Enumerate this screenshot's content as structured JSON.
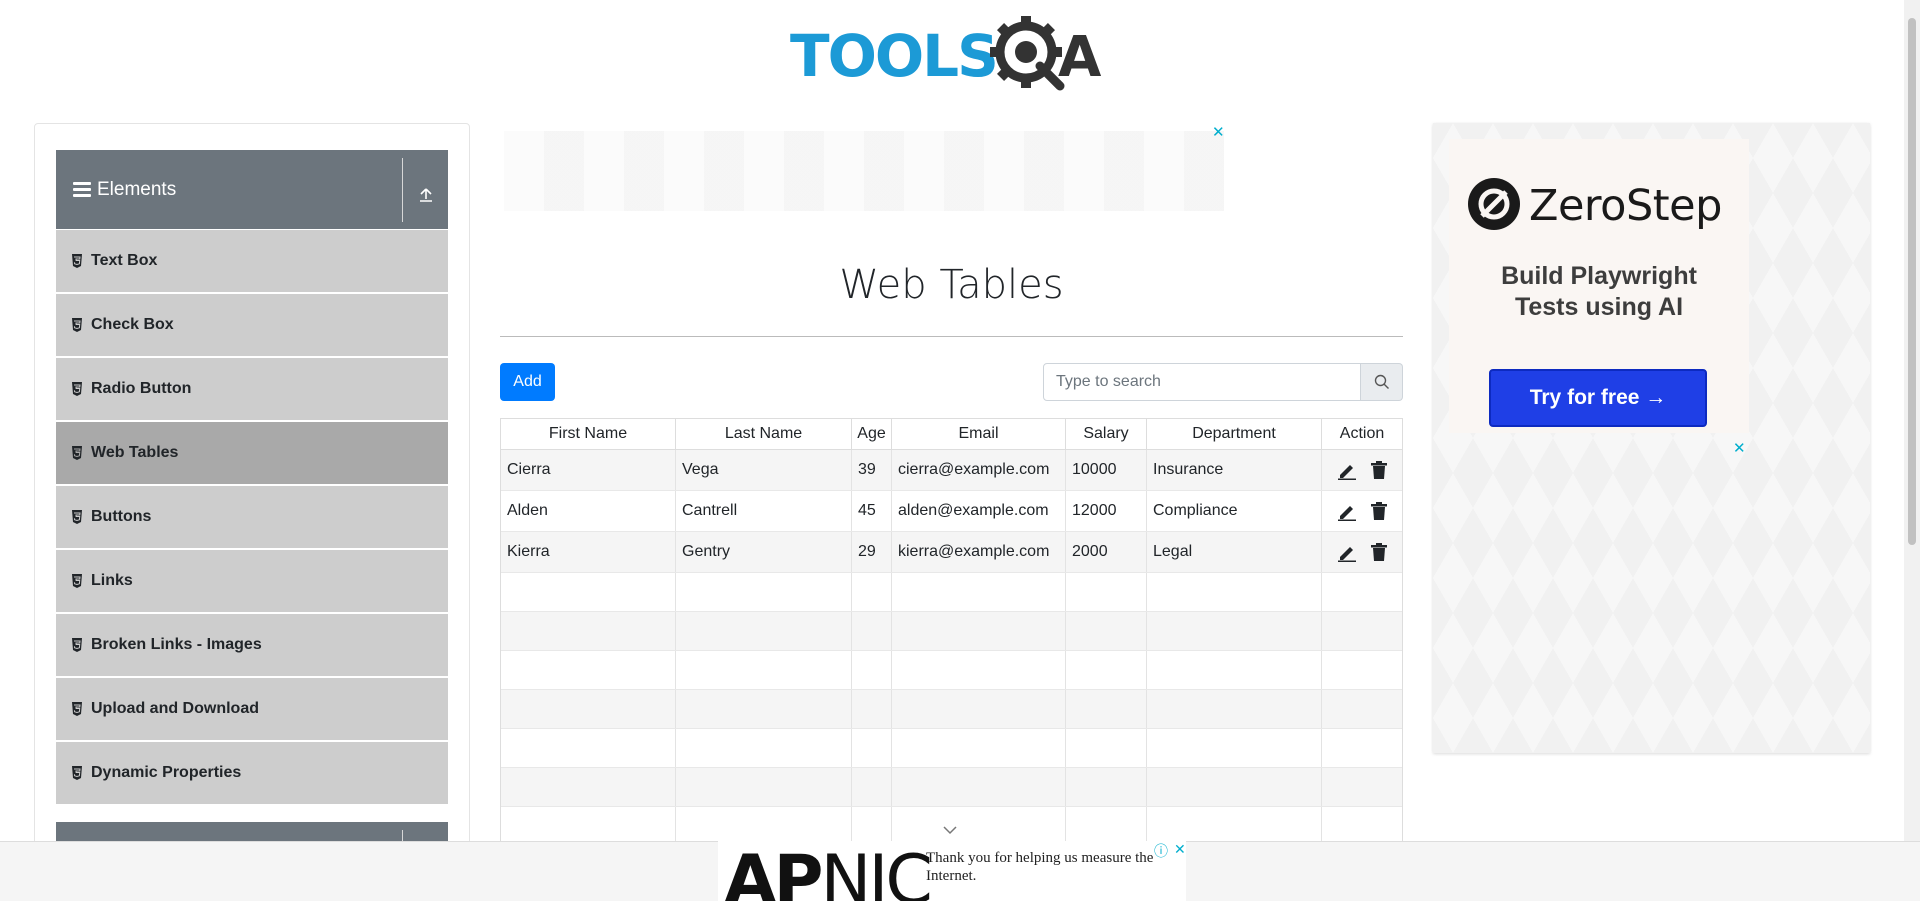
{
  "brand": {
    "logo_text": "TOOLSQA"
  },
  "sidebar": {
    "group_title": "Elements",
    "items": [
      {
        "label": "Text Box",
        "active": false
      },
      {
        "label": "Check Box",
        "active": false
      },
      {
        "label": "Radio Button",
        "active": false
      },
      {
        "label": "Web Tables",
        "active": true
      },
      {
        "label": "Buttons",
        "active": false
      },
      {
        "label": "Links",
        "active": false
      },
      {
        "label": "Broken Links - Images",
        "active": false
      },
      {
        "label": "Upload and Download",
        "active": false
      },
      {
        "label": "Dynamic Properties",
        "active": false
      }
    ]
  },
  "top_ad": {
    "close": "✕"
  },
  "main": {
    "title": "Web Tables",
    "add_label": "Add",
    "search": {
      "placeholder": "Type to search",
      "value": ""
    },
    "table": {
      "columns": [
        "First Name",
        "Last Name",
        "Age",
        "Email",
        "Salary",
        "Department",
        "Action"
      ],
      "rows": [
        [
          "Cierra",
          "Vega",
          "39",
          "cierra@example.com",
          "10000",
          "Insurance"
        ],
        [
          "Alden",
          "Cantrell",
          "45",
          "alden@example.com",
          "12000",
          "Compliance"
        ],
        [
          "Kierra",
          "Gentry",
          "29",
          "kierra@example.com",
          "2000",
          "Legal"
        ]
      ],
      "empty_rows": 7
    }
  },
  "right_ad": {
    "brand": "ZeroStep",
    "tagline_line1": "Build Playwright",
    "tagline_line2": "Tests using AI",
    "cta": "Try for free →",
    "close": "✕"
  },
  "bottom_ad": {
    "logo_bold": "AP",
    "logo_rest": "NIC",
    "text": "Thank you for helping us measure the Internet.",
    "info": "ⓘ",
    "close": "✕"
  },
  "colors": {
    "primary": "#007bff",
    "sidebar_header": "#6c757d",
    "menu_item": "#cdcdcd",
    "menu_item_active": "#a9a9a9",
    "logo_blue": "#1c9ad6",
    "logo_dark": "#333333",
    "cta_blue": "#1f3fe6"
  }
}
